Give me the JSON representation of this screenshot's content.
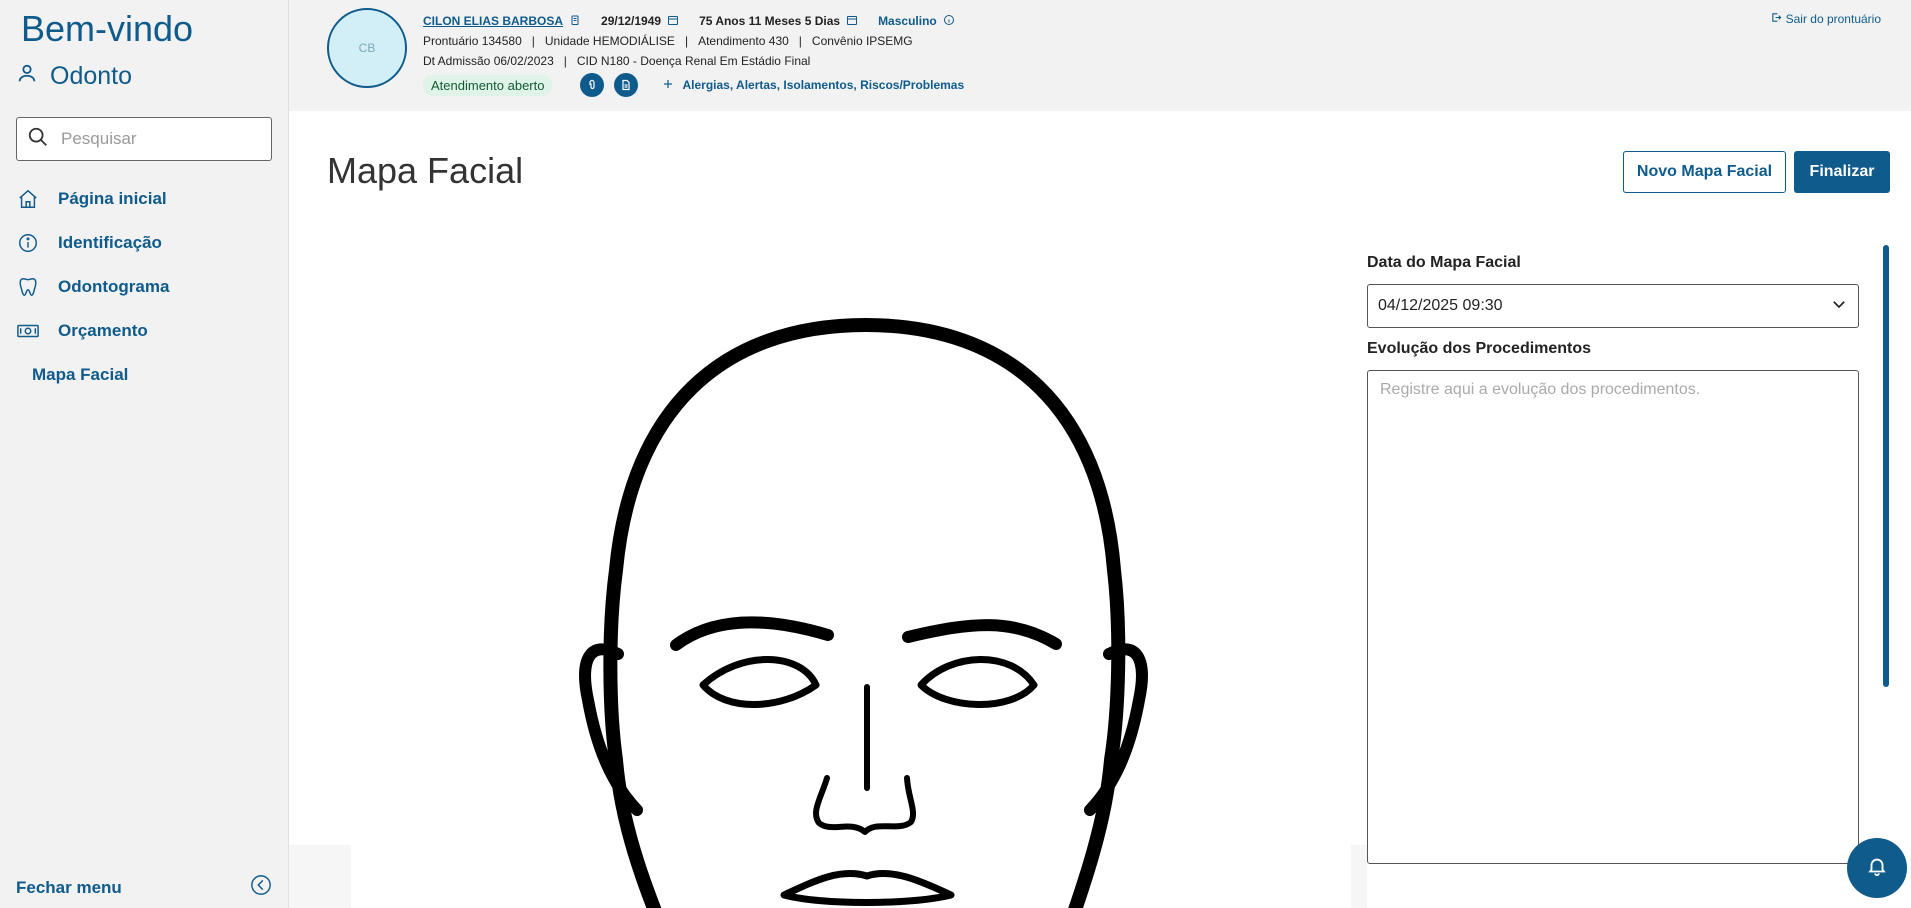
{
  "sidebar": {
    "welcome": "Bem-vindo",
    "user": "Odonto",
    "search_placeholder": "Pesquisar",
    "items": [
      {
        "label": "Página inicial",
        "icon": "home-icon"
      },
      {
        "label": "Identificação",
        "icon": "info-icon"
      },
      {
        "label": "Odontograma",
        "icon": "tooth-icon"
      },
      {
        "label": "Orçamento",
        "icon": "money-icon"
      }
    ],
    "sub_item": "Mapa Facial",
    "close_menu": "Fechar menu"
  },
  "patient": {
    "initials": "CB",
    "name": "CILON ELIAS BARBOSA",
    "birth_date": "29/12/1949",
    "age": "75 Anos 11 Meses 5 Dias",
    "sex": "Masculino",
    "prontuario": "Prontuário 134580",
    "unidade": "Unidade HEMODIÁLISE",
    "atendimento": "Atendimento 430",
    "convenio": "Convênio IPSEMG",
    "admissao": "Dt Admissão 06/02/2023",
    "cid": "CID N180 - Doença Renal Em Estádio Final",
    "status": "Atendimento aberto",
    "alerts": "Alergias, Alertas, Isolamentos, Riscos/Problemas"
  },
  "header": {
    "exit": "Sair do prontuário"
  },
  "main": {
    "title": "Mapa Facial",
    "new_button": "Novo Mapa Facial",
    "finish_button": "Finalizar",
    "date_label": "Data do Mapa Facial",
    "date_value": "04/12/2025 09:30",
    "evolution_label": "Evolução dos Procedimentos",
    "evolution_placeholder": "Registre aqui a evolução dos procedimentos."
  },
  "colors": {
    "primary": "#0f5b8c",
    "sidebar_bg": "#f2f2f2",
    "status_bg": "#dff3e8"
  }
}
